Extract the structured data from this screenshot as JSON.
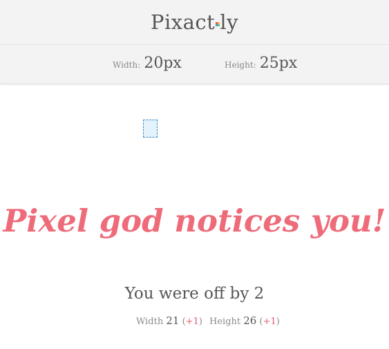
{
  "app": {
    "logo_prefix": "Pixact",
    "logo_suffix": "ly"
  },
  "challenge": {
    "width_label": "Width:",
    "width_value": "20px",
    "height_label": "Height:",
    "height_value": "25px"
  },
  "result": {
    "headline": "Pixel god notices you!",
    "summary": "You were off by 2",
    "width_label": "Width",
    "width_value": "21",
    "width_delta": "+1",
    "height_label": "Height",
    "height_value": "26",
    "height_delta": "+1"
  },
  "colors": {
    "accent": "#ee6b7a",
    "delta": "#e8566c",
    "box_border": "#3a8fc7",
    "box_fill": "#e4f3fb"
  }
}
